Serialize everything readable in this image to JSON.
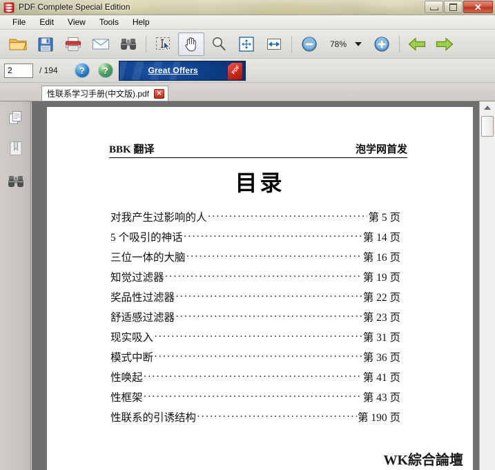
{
  "window": {
    "title": "PDF Complete Special Edition",
    "app_icon": "pdf-complete-icon",
    "controls": {
      "minimize": "minimize-button",
      "maximize": "maximize-button",
      "close_label": "✕"
    }
  },
  "menubar": {
    "items": [
      {
        "label": "File",
        "name": "menu-file"
      },
      {
        "label": "Edit",
        "name": "menu-edit"
      },
      {
        "label": "View",
        "name": "menu-view"
      },
      {
        "label": "Tools",
        "name": "menu-tools"
      },
      {
        "label": "Help",
        "name": "menu-help"
      }
    ]
  },
  "toolbar": {
    "buttons": [
      {
        "name": "open-button",
        "icon": "folder-open-icon"
      },
      {
        "name": "save-button",
        "icon": "save-floppy-icon"
      },
      {
        "name": "print-button",
        "icon": "printer-icon"
      },
      {
        "name": "email-button",
        "icon": "envelope-icon"
      },
      {
        "name": "find-button",
        "icon": "binoculars-icon"
      },
      {
        "name": "select-text-button",
        "icon": "text-select-icon"
      },
      {
        "name": "hand-tool-button",
        "icon": "hand-icon"
      },
      {
        "name": "zoom-tool-button",
        "icon": "magnifier-icon"
      },
      {
        "name": "fit-page-button",
        "icon": "fit-page-icon"
      },
      {
        "name": "fit-width-button",
        "icon": "fit-width-icon"
      }
    ],
    "selected_tool": "hand-tool-button",
    "zoom_out": "zoom-out-button",
    "zoom_in": "zoom-in-button",
    "zoom_value": "78%",
    "zoom_dropdown": "zoom-dropdown-arrow",
    "prev_page": "previous-page-arrow",
    "next_page": "next-page-arrow"
  },
  "navbar": {
    "current_page": "2",
    "current_page_placeholder": "1",
    "page_total": "/ 194",
    "help_button": "help-question-icon",
    "online_help_button": "globe-help-icon",
    "offers": {
      "label": "Great Offers",
      "tag_label": "PDF"
    }
  },
  "tabs": [
    {
      "label": "性联系学习手册(中文版).pdf",
      "close_label": "✕",
      "active": true
    }
  ],
  "sidebar": {
    "items": [
      {
        "name": "sidebar-pages-panel",
        "icon": "pages-icon"
      },
      {
        "name": "sidebar-bookmarks-panel",
        "icon": "bookmark-icon"
      },
      {
        "name": "sidebar-search-panel",
        "icon": "binoculars-icon"
      }
    ]
  },
  "document": {
    "header_left": "BBK 翻译",
    "header_right": "泡学网首发",
    "title": "目录",
    "toc": [
      {
        "title": "对我产生过影响的人",
        "page": "第 5 页"
      },
      {
        "title": "5 个吸引的神话",
        "page": "第 14 页"
      },
      {
        "title": "三位一体的大脑",
        "page": "第 16 页"
      },
      {
        "title": "知觉过滤器",
        "page": "第 19 页"
      },
      {
        "title": "奖品性过滤器",
        "page": "第 22 页"
      },
      {
        "title": "舒适感过滤器",
        "page": "第 23 页"
      },
      {
        "title": "现实吸入",
        "page": "第 31 页"
      },
      {
        "title": "模式中断",
        "page": "第 36 页"
      },
      {
        "title": "性唤起",
        "page": "第 41 页"
      },
      {
        "title": "性框架",
        "page": "第 43 页"
      },
      {
        "title": "性联系的引诱结构",
        "page": "第 190 页"
      }
    ],
    "watermark": "WK綜合論壇"
  },
  "scrollbar": {
    "up_arrow": "scroll-up-arrow",
    "thumb": "scroll-thumb"
  },
  "colors": {
    "accent_blue": "#0d3d86",
    "close_red": "#b8381f",
    "page_bg": "#ffffff",
    "viewport_gray": "#6e6e6e"
  }
}
